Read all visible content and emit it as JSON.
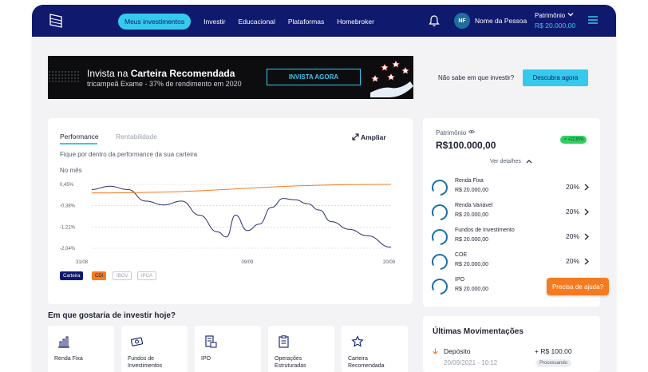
{
  "header": {
    "nav": [
      "Meus investimentos",
      "Investir",
      "Educacional",
      "Plataformas",
      "Homebroker"
    ],
    "avatar_initials": "NF",
    "user_name": "Nome da Pessoa",
    "patrimonio_label": "Patrimônio",
    "patrimonio_value": "R$ 20.000,00",
    "icons": [
      "logo-icon",
      "bell-icon",
      "chevron-down-icon",
      "hamburger-menu-icon"
    ]
  },
  "banner": {
    "line1_prefix": "Invista na ",
    "line1_bold": "Carteira Recomendada",
    "line2": "tricampeã Exame - 37% de rendimento em 2020",
    "cta": "INVISTA AGORA"
  },
  "help_prompt": {
    "text": "Não sabe em que investir?",
    "button": "Descubra agora"
  },
  "performance": {
    "tabs": [
      "Performance",
      "Rentabilidade"
    ],
    "ampliar": "Ampliar",
    "subtitle": "Fique por dentro da performance da sua carteira",
    "period": "No mês",
    "legend": [
      "Carteira",
      "CDI",
      "IBOV",
      "IPCA"
    ]
  },
  "chart_data": {
    "type": "line",
    "yticks": [
      "0,45%",
      "-0,38%",
      "-1,21%",
      "-2,04%"
    ],
    "yvalues": [
      0.45,
      -0.38,
      -1.21,
      -2.04
    ],
    "ylim": [
      -2.04,
      0.45
    ],
    "xticks": [
      "31/08",
      "09/09",
      "20/09"
    ],
    "series": [
      {
        "name": "Carteira",
        "color": "#2b2f6b",
        "x": [
          0,
          0.06,
          0.12,
          0.18,
          0.24,
          0.3,
          0.36,
          0.42,
          0.45,
          0.48,
          0.52,
          0.56,
          0.6,
          0.64,
          0.68,
          0.72,
          0.76,
          0.8,
          0.86,
          0.92,
          1.0
        ],
        "y": [
          0.25,
          0.38,
          0.25,
          -0.2,
          -0.35,
          -0.2,
          -0.75,
          -1.4,
          -1.6,
          -0.75,
          -1.35,
          -1.1,
          -0.45,
          -0.1,
          -0.15,
          -0.3,
          -0.55,
          -1.0,
          -1.3,
          -1.55,
          -2.0
        ]
      },
      {
        "name": "CDI",
        "color": "#f47b20",
        "x": [
          0,
          1.0
        ],
        "y": [
          0.12,
          0.45
        ]
      }
    ]
  },
  "portfolio": {
    "label": "Patrimônio",
    "value": "R$100.000,00",
    "badge": "↗ +12,55%",
    "details": "Ver detalhes",
    "assets": [
      {
        "name": "Renda Fixa",
        "value": "R$ 20.000,00",
        "pct": "20%"
      },
      {
        "name": "Renda Variável",
        "value": "R$ 20.000,00",
        "pct": "20%"
      },
      {
        "name": "Fundos de Investimento",
        "value": "R$ 20.000,00",
        "pct": "20%"
      },
      {
        "name": "COE",
        "value": "R$ 20.000,00",
        "pct": "20%"
      },
      {
        "name": "IPO",
        "value": "R$ 20.000,00",
        "pct": ""
      }
    ]
  },
  "help_button": "Precisa de ajuda?",
  "invest_today": {
    "title": "Em que gostaria de investir hoje?",
    "products": [
      {
        "label": "Renda Fixa",
        "icon": "bar-chart-icon"
      },
      {
        "label": "Fundos de Investimentos",
        "icon": "money-icon"
      },
      {
        "label": "IPO",
        "icon": "document-icon"
      },
      {
        "label": "Operações Estruturadas",
        "icon": "clipboard-icon"
      },
      {
        "label": "Carteira Recomendada",
        "icon": "star-icon"
      }
    ]
  },
  "movements": {
    "title": "Últimas Movimentações",
    "items": [
      {
        "type": "Depósito",
        "amount": "+ R$ 100,00",
        "date": "20/09/2021 - 10:12",
        "status": "Processando"
      }
    ]
  }
}
